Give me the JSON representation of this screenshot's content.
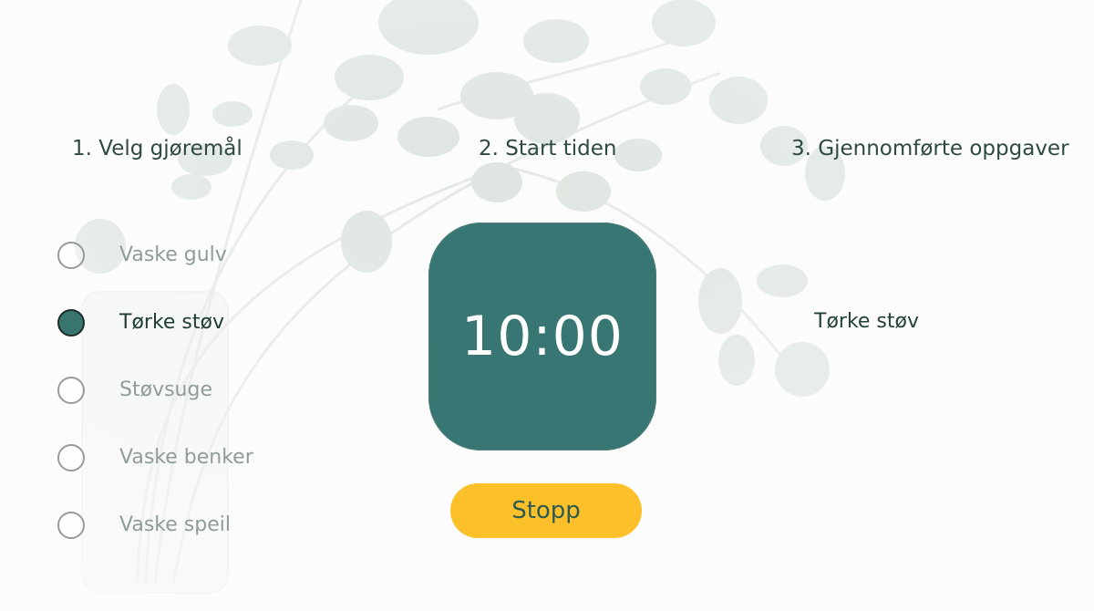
{
  "steps": {
    "choose_task": "1. Velg gjøremål",
    "start_timer": "2. Start tiden",
    "completed_tasks": "3. Gjennomførte oppgaver"
  },
  "tasks": [
    {
      "label": "Vaske gulv",
      "selected": false
    },
    {
      "label": "Tørke støv",
      "selected": true
    },
    {
      "label": "Støvsuge",
      "selected": false
    },
    {
      "label": "Vaske benker",
      "selected": false
    },
    {
      "label": "Vaske speil",
      "selected": false
    }
  ],
  "timer": {
    "value": "10:00"
  },
  "stop_button": {
    "label": "Stopp"
  },
  "completed": [
    "Tørke støv"
  ],
  "colors": {
    "accent": "#377672",
    "button": "#fbc02a",
    "text_dark": "#2e4a41",
    "text_muted": "#8e9d97"
  }
}
